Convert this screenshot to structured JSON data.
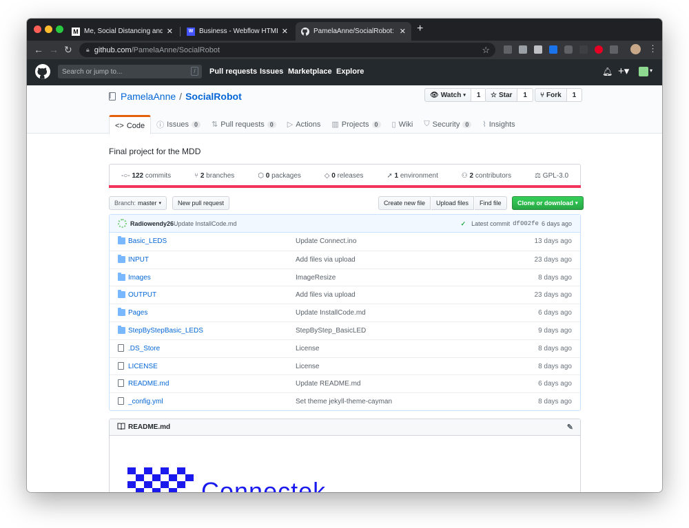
{
  "browser": {
    "tabs": [
      {
        "favicon": "M",
        "title": "Me, Social Distancing and My I",
        "active": false
      },
      {
        "favicon": "W",
        "title": "Business - Webflow HTML web",
        "active": false
      },
      {
        "favicon": "github",
        "title": "PamelaAnne/SocialRobot: Final",
        "active": true
      }
    ],
    "url_host": "github.com",
    "url_path": "/PamelaAnne/SocialRobot"
  },
  "gh_header": {
    "search_placeholder": "Search or jump to...",
    "search_hotkey": "/",
    "nav": [
      "Pull requests",
      "Issues",
      "Marketplace",
      "Explore"
    ]
  },
  "repo": {
    "owner": "PamelaAnne",
    "separator": "/",
    "name": "SocialRobot",
    "watch_label": "Watch",
    "watch_count": "1",
    "star_label": "Star",
    "star_count": "1",
    "fork_label": "Fork",
    "fork_count": "1",
    "tabs": [
      {
        "label": "Code",
        "icon": "code-icon",
        "count": null
      },
      {
        "label": "Issues",
        "icon": "issue-icon",
        "count": "0"
      },
      {
        "label": "Pull requests",
        "icon": "pr-icon",
        "count": "0"
      },
      {
        "label": "Actions",
        "icon": "play-icon",
        "count": null
      },
      {
        "label": "Projects",
        "icon": "project-icon",
        "count": "0"
      },
      {
        "label": "Wiki",
        "icon": "book-icon",
        "count": null
      },
      {
        "label": "Security",
        "icon": "shield-icon",
        "count": "0"
      },
      {
        "label": "Insights",
        "icon": "graph-icon",
        "count": null
      }
    ],
    "description": "Final project for the MDD",
    "summary": [
      {
        "num": "122",
        "label": "commits"
      },
      {
        "num": "2",
        "label": "branches"
      },
      {
        "num": "0",
        "label": "packages"
      },
      {
        "num": "0",
        "label": "releases"
      },
      {
        "num": "1",
        "label": "environment"
      },
      {
        "num": "2",
        "label": "contributors"
      },
      {
        "num": "",
        "label": "GPL-3.0"
      }
    ],
    "language_color": "#f1345a"
  },
  "filebar": {
    "branch_label": "Branch:",
    "branch": "master",
    "new_pr": "New pull request",
    "create_file": "Create new file",
    "upload_files": "Upload files",
    "find_file": "Find file",
    "clone": "Clone or download"
  },
  "latest_commit": {
    "author": "Radiowendy26",
    "message": "Update InstallCode.md",
    "prefix": "Latest commit",
    "sha": "df002fe",
    "age": "6 days ago"
  },
  "files": [
    {
      "type": "dir",
      "name": "Basic_LEDS",
      "message": "Update Connect.ino",
      "age": "13 days ago"
    },
    {
      "type": "dir",
      "name": "INPUT",
      "message": "Add files via upload",
      "age": "23 days ago"
    },
    {
      "type": "dir",
      "name": "Images",
      "message": "ImageResize",
      "age": "8 days ago"
    },
    {
      "type": "dir",
      "name": "OUTPUT",
      "message": "Add files via upload",
      "age": "23 days ago"
    },
    {
      "type": "dir",
      "name": "Pages",
      "message": "Update InstallCode.md",
      "age": "6 days ago"
    },
    {
      "type": "dir",
      "name": "StepByStepBasic_LEDS",
      "message": "StepByStep_BasicLED",
      "age": "9 days ago"
    },
    {
      "type": "file",
      "name": ".DS_Store",
      "message": "License",
      "age": "8 days ago"
    },
    {
      "type": "file",
      "name": "LICENSE",
      "message": "License",
      "age": "8 days ago"
    },
    {
      "type": "file",
      "name": "README.md",
      "message": "Update README.md",
      "age": "6 days ago"
    },
    {
      "type": "file",
      "name": "_config.yml",
      "message": "Set theme jekyll-theme-cayman",
      "age": "8 days ago"
    }
  ],
  "readme": {
    "filename": "README.md",
    "logo_text": "Connectek"
  }
}
